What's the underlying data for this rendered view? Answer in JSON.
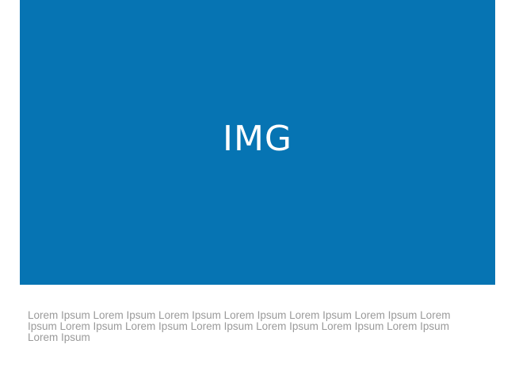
{
  "image": {
    "label": "IMG",
    "color": "#0674b3"
  },
  "caption": {
    "text": "Lorem Ipsum Lorem Ipsum Lorem Ipsum Lorem Ipsum Lorem Ipsum Lorem Ipsum Lorem Ipsum Lorem Ipsum Lorem Ipsum Lorem Ipsum Lorem Ipsum Lorem Ipsum Lorem Ipsum Lorem Ipsum"
  }
}
